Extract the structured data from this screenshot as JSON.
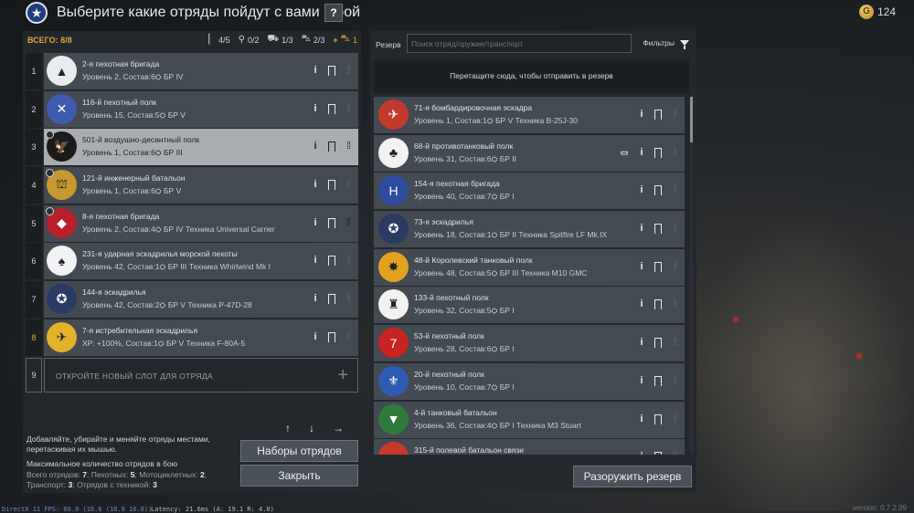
{
  "header": {
    "title": "Выберите какие отряды пойдут с вами в бой",
    "help_label": "?",
    "currency": "124"
  },
  "stats": {
    "total": "ВСЕГО: 8/8",
    "infantry": "4/5",
    "motorcycle": "0/2",
    "transport": "1/3",
    "tech": "2/3",
    "plus": "+",
    "bonus": "1"
  },
  "slots": [
    {
      "num": "1",
      "name": "2-я пехотная бригада",
      "meta": "Уровень 2, Состав:6⛭ БР IV",
      "emblem_color": "#e9ecef",
      "emblem_glyph": "▲",
      "lock": false
    },
    {
      "num": "2",
      "name": "116-й пехотный полк",
      "meta": "Уровень 15, Состав:5⛭ БР V",
      "emblem_color": "#3e5bb0",
      "emblem_glyph": "✕",
      "lock": false
    },
    {
      "num": "3",
      "name": "501-й воздушно-десантный полк",
      "meta": "Уровень 1, Состав:6⛭ БР III",
      "emblem_color": "#1b1b1b",
      "emblem_glyph": "🦅",
      "lock": true
    },
    {
      "num": "4",
      "name": "121-й инженерный батальон",
      "meta": "Уровень 1, Состав:6⛭ БР V",
      "emblem_color": "#c6982f",
      "emblem_glyph": "⛫",
      "lock": true
    },
    {
      "num": "5",
      "name": "8-я пехотная бригада",
      "meta": "Уровень 2, Состав:4⛭ БР IV  Техника Universal Carrier",
      "emblem_color": "#b81f2a",
      "emblem_glyph": "◆",
      "lock": true
    },
    {
      "num": "6",
      "name": "231-я ударная эскадрилья морской пехоты",
      "meta": "Уровень 42, Состав:1⛭ БР III  Техника Whirlwind Mk I",
      "emblem_color": "#f1f2f3",
      "emblem_glyph": "♠",
      "lock": false
    },
    {
      "num": "7",
      "name": "144-я эскадрилья",
      "meta": "Уровень 42, Состав:2⛭ БР V  Техника P-47D-28",
      "emblem_color": "#2a3c66",
      "emblem_glyph": "✪",
      "lock": false
    },
    {
      "num": "8",
      "name": "7-я истребительная эскадрилья",
      "meta": "XP: +100%, Состав:1⛭ БР V  Техника F-80A-5",
      "emblem_color": "#e3b12a",
      "emblem_glyph": "✈",
      "lock": false
    }
  ],
  "empty_slot": {
    "num": "9",
    "label": "ОТКРОЙТЕ НОВЫЙ СЛОТ ДЛЯ ОТРЯДА",
    "plus": "+"
  },
  "arrows": {
    "up": "↑",
    "down": "↓",
    "right": "→"
  },
  "hint": "Добавляйте, убирайте и меняйте отряды местами, перетаскивая их мышью.",
  "max": {
    "title": "Максимальное количество отрядов в бою",
    "total_label": "Всего отрядов:",
    "total": "7",
    "inf_label": "Пехотных:",
    "inf": "5",
    "moto_label": "Мотоциклетных:",
    "moto": "2",
    "trans_label": "Транспорт:",
    "trans": "3",
    "tech_label": "Отрядов с техникой:",
    "tech": "3"
  },
  "buttons": {
    "presets": "Наборы отрядов",
    "close": "Закрыть",
    "disarm": "Разоружить резерв"
  },
  "reserve": {
    "label": "Резерв",
    "search_placeholder": "Поиск отряд/оружие/транспорт",
    "filters": "Фильтры",
    "dropzone": "Перетащите сюда, чтобы отправить в резерв",
    "items": [
      {
        "name": "71-я бомбардировочная эскадра",
        "meta": "Уровень 1, Состав:1⛭ БР V  Техника B-25J-30",
        "emblem_color": "#c23a2c",
        "emblem_glyph": "✈",
        "book": false
      },
      {
        "name": "68-й противотанковый полк",
        "meta": "Уровень 31, Состав:6⛭ БР II",
        "emblem_color": "#f2f2f2",
        "emblem_glyph": "♣",
        "book": true
      },
      {
        "name": "154-я пехотная бригада",
        "meta": "Уровень 40, Состав:7⛭ БР I",
        "emblem_color": "#2d4c9e",
        "emblem_glyph": "H",
        "book": false
      },
      {
        "name": "73-я эскадрилья",
        "meta": "Уровень 18, Состав:1⛭ БР II  Техника Spitfire LF Mk.IX",
        "emblem_color": "#2b3b63",
        "emblem_glyph": "✪",
        "book": false
      },
      {
        "name": "48-й Королевский танковый полк",
        "meta": "Уровень 48, Состав:5⛭ БР III  Техника M10 GMC",
        "emblem_color": "#e2a21f",
        "emblem_glyph": "✸",
        "book": false
      },
      {
        "name": "133-й пехотный полк",
        "meta": "Уровень 32, Состав:5⛭ БР I",
        "emblem_color": "#f2f2f2",
        "emblem_glyph": "♜",
        "book": false
      },
      {
        "name": "53-й пехотный полк",
        "meta": "Уровень 28, Состав:6⛭ БР I",
        "emblem_color": "#c82222",
        "emblem_glyph": "7",
        "book": false
      },
      {
        "name": "20-й пехотный полк",
        "meta": "Уровень 10, Состав:7⛭ БР I",
        "emblem_color": "#2d5bb3",
        "emblem_glyph": "⚜",
        "book": false
      },
      {
        "name": "4-й танковый батальон",
        "meta": "Уровень 36, Состав:4⛭ БР I  Техника M3 Stuart",
        "emblem_color": "#2f7a3a",
        "emblem_glyph": "▼",
        "book": false
      },
      {
        "name": "315-й полевой батальон связи",
        "meta": "",
        "emblem_color": "#c8392b",
        "emblem_glyph": "■",
        "book": true
      }
    ]
  },
  "debug": {
    "left": "DirectX 11 FPS: 60.0 (16.6 (16.9 16.6))",
    "mid": "Latency: 21.6ms (A: 19.1 R: 4.0)",
    "version": "version: 0.7.2.99"
  },
  "colors": {
    "accent": "#e3a33a",
    "panel": "#24282d",
    "card": "#434a52",
    "selected": "#a9adb1"
  }
}
